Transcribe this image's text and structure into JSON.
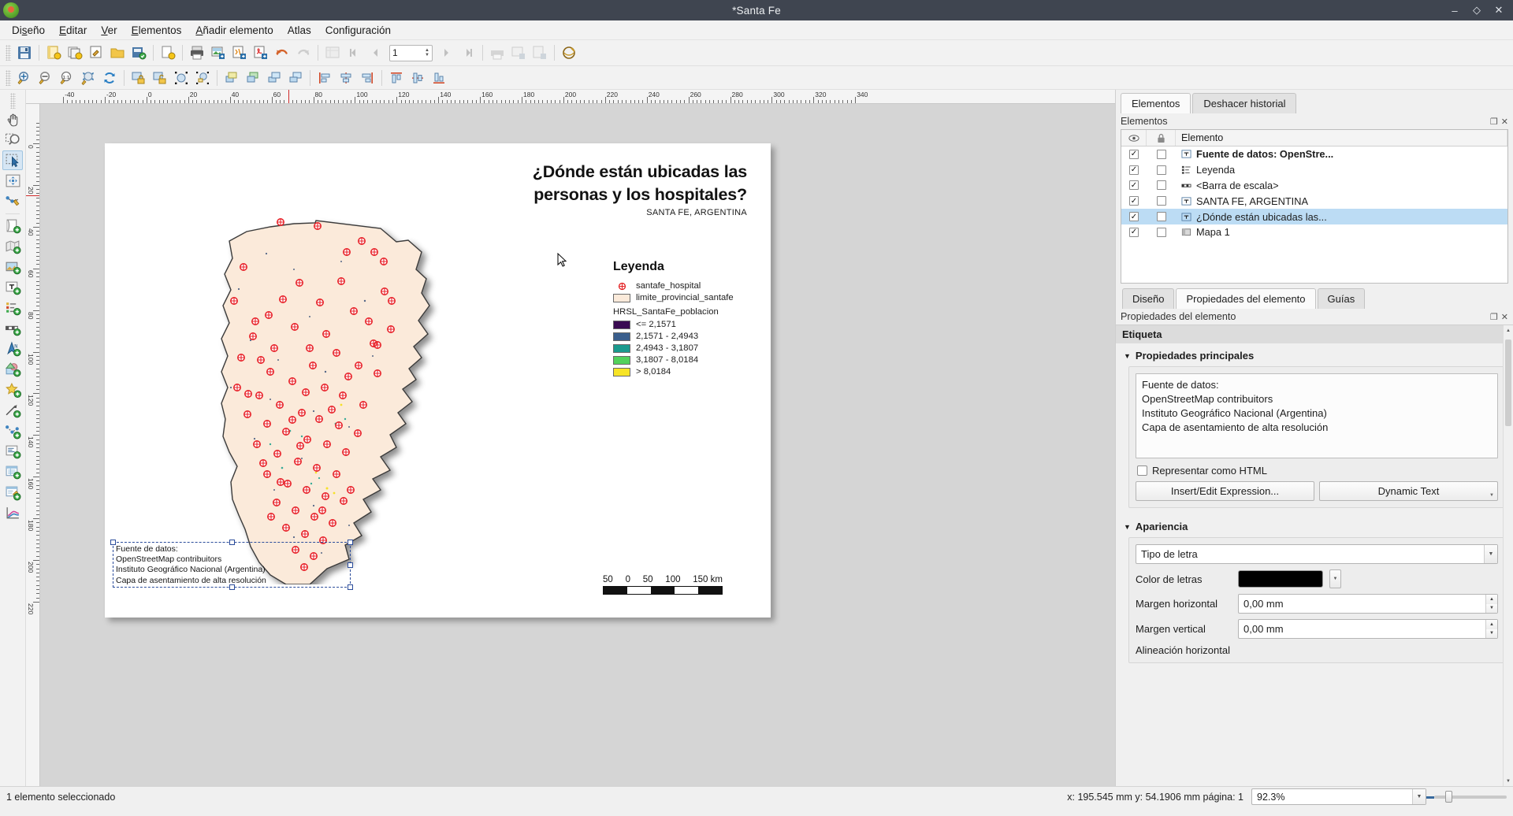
{
  "window": {
    "title": "*Santa Fe",
    "app_icon": "qgis-logo-icon",
    "controls": {
      "minimize": "–",
      "restore": "◇",
      "close": "✕"
    }
  },
  "menubar": [
    {
      "label": "Diseño",
      "accel": "s"
    },
    {
      "label": "Editar",
      "accel": "E"
    },
    {
      "label": "Ver",
      "accel": "V"
    },
    {
      "label": "Elementos",
      "accel": "E"
    },
    {
      "label": "Añadir elemento",
      "accel": "A"
    },
    {
      "label": "Atlas",
      "accel": ""
    },
    {
      "label": "Configuración",
      "accel": ""
    }
  ],
  "toolbar_main": [
    "save-icon",
    "new-layout-icon",
    "duplicate-layout-icon",
    "layout-manager-icon",
    "open-template-icon",
    "save-template-icon",
    "new-report-icon",
    "print-icon",
    "export-image-icon",
    "export-svg-icon",
    "export-pdf-icon",
    "undo-icon",
    "redo-icon",
    "atlas-settings-icon",
    "atlas-first-icon",
    "atlas-prev-icon",
    "atlas-next-icon",
    "atlas-last-icon",
    "atlas-print-icon",
    "atlas-export-image-icon",
    "atlas-export-icon",
    "atlas-preview-icon"
  ],
  "toolbar_main_page_value": "1",
  "toolbar_nav": [
    "zoom-in-icon",
    "zoom-out-icon",
    "zoom-100-icon",
    "zoom-full-icon",
    "refresh-icon",
    "lock-items-icon",
    "unlock-items-icon",
    "group-icon",
    "ungroup-icon",
    "raise-items-icon",
    "lower-items-icon",
    "raise-to-top-icon",
    "lower-to-bottom-icon",
    "align-left-icon",
    "align-center-icon",
    "align-right-icon",
    "align-top-icon",
    "align-middle-icon",
    "align-bottom-icon"
  ],
  "toolbar_left": [
    "pan-layout-icon",
    "zoom-tool-icon",
    "select-move-item-icon",
    "move-item-content-icon",
    "edit-nodes-icon",
    "add-page-icon",
    "add-map-icon",
    "add-picture-icon",
    "add-label-icon",
    "add-legend-icon",
    "add-scalebar-icon",
    "add-north-arrow-icon",
    "add-shape-icon",
    "add-marker-icon",
    "add-arrow-icon",
    "add-node-item-icon",
    "add-html-icon",
    "add-table-icon",
    "add-attribute-table-icon",
    "add-elevation-profile-icon"
  ],
  "rulers": {
    "h_labels": [
      "-20",
      "0",
      "20",
      "40",
      "60",
      "80",
      "100",
      "120",
      "140",
      "160",
      "180",
      "200",
      "220",
      "240",
      "260",
      "280",
      "300",
      "320"
    ],
    "v_labels": [
      "0",
      "20",
      "40",
      "60",
      "80",
      "100",
      "120",
      "140",
      "160",
      "180",
      "200"
    ],
    "unit": "mm"
  },
  "layout": {
    "title_line1": "¿Dónde están ubicadas las",
    "title_line2": "personas y los hospitales?",
    "subtitle": "SANTA FE, ARGENTINA",
    "legend": {
      "heading": "Leyenda",
      "point_layer": {
        "label": "santafe_hospital",
        "symbol": "red-circle-cross-marker",
        "color": "#e31a1c"
      },
      "polygon_layer": {
        "label": "limite_provincial_santafe",
        "color": "#fbeada",
        "outline": "#6a6a6a"
      },
      "raster_group": "HRSL_SantaFe_poblacion",
      "classes": [
        {
          "label": "<= 2,1571",
          "color": "#3a0b52"
        },
        {
          "label": "2,1571 - 2,4943",
          "color": "#3a5e8c"
        },
        {
          "label": "2,4943 - 3,1807",
          "color": "#1a9a8e"
        },
        {
          "label": "3,1807 - 8,0184",
          "color": "#52d15c"
        },
        {
          "label": "> 8,0184",
          "color": "#f7e426"
        }
      ]
    },
    "scalebar": {
      "labels": [
        "50",
        "0",
        "50",
        "100",
        "150 km"
      ],
      "segments": 5
    },
    "credits": [
      "Fuente de datos:",
      "OpenStreetMap contribuitors",
      "Instituto Geográfico Nacional (Argentina)",
      "Capa de asentamiento de alta resolución"
    ]
  },
  "right_panel": {
    "tabs": [
      {
        "label": "Elementos",
        "active": true
      },
      {
        "label": "Deshacer historial",
        "active": false
      }
    ],
    "elements_panel_title": "Elementos",
    "table_headers": {
      "visibility": "eye-icon",
      "lock": "lock-icon",
      "element": "Elemento"
    },
    "rows": [
      {
        "name": "Fuente de datos: OpenStre...",
        "icon": "label-item-icon",
        "visible": "✓",
        "locked": "",
        "bold": true,
        "selected": false
      },
      {
        "name": "Leyenda",
        "icon": "legend-item-icon",
        "visible": "✓",
        "locked": "",
        "bold": false,
        "selected": false
      },
      {
        "name": "<Barra de escala>",
        "icon": "scalebar-item-icon",
        "visible": "✓",
        "locked": "",
        "bold": false,
        "selected": false
      },
      {
        "name": "SANTA FE, ARGENTINA",
        "icon": "label-item-icon",
        "visible": "✓",
        "locked": "",
        "bold": false,
        "selected": false
      },
      {
        "name": "¿Dónde están ubicadas las...",
        "icon": "label-item-icon",
        "visible": "✓",
        "locked": "",
        "bold": false,
        "selected": true
      },
      {
        "name": "Mapa 1",
        "icon": "map-item-icon",
        "visible": "✓",
        "locked": "",
        "bold": false,
        "selected": false
      }
    ],
    "sub_tabs": [
      {
        "label": "Diseño",
        "active": false
      },
      {
        "label": "Propiedades del elemento",
        "active": true
      },
      {
        "label": "Guías",
        "active": false
      }
    ],
    "props_panel_title": "Propiedades del elemento",
    "section_title": "Etiqueta",
    "group_main": {
      "title": "Propiedades principales",
      "text_value": "Fuente de datos:\nOpenStreetMap contribuitors\nInstituto Geográfico Nacional (Argentina)\nCapa de asentamiento de alta resolución",
      "render_html_label": "Representar como HTML",
      "render_html_checked": false,
      "btn_expression": "Insert/Edit Expression...",
      "btn_dynamic_text": "Dynamic Text"
    },
    "group_appearance": {
      "title": "Apariencia",
      "font_label": "Tipo de letra",
      "font_color_label": "Color de letras",
      "font_color_value": "#000000",
      "margin_h_label": "Margen horizontal",
      "margin_h_value": "0,00 mm",
      "margin_v_label": "Margen vertical",
      "margin_v_value": "0,00 mm",
      "align_h_label": "Alineación horizontal"
    }
  },
  "statusbar": {
    "selection": "1 elemento seleccionado",
    "coords": "x: 195.545 mm  y: 54.1906 mm  página: 1",
    "zoom": "92.3%"
  }
}
